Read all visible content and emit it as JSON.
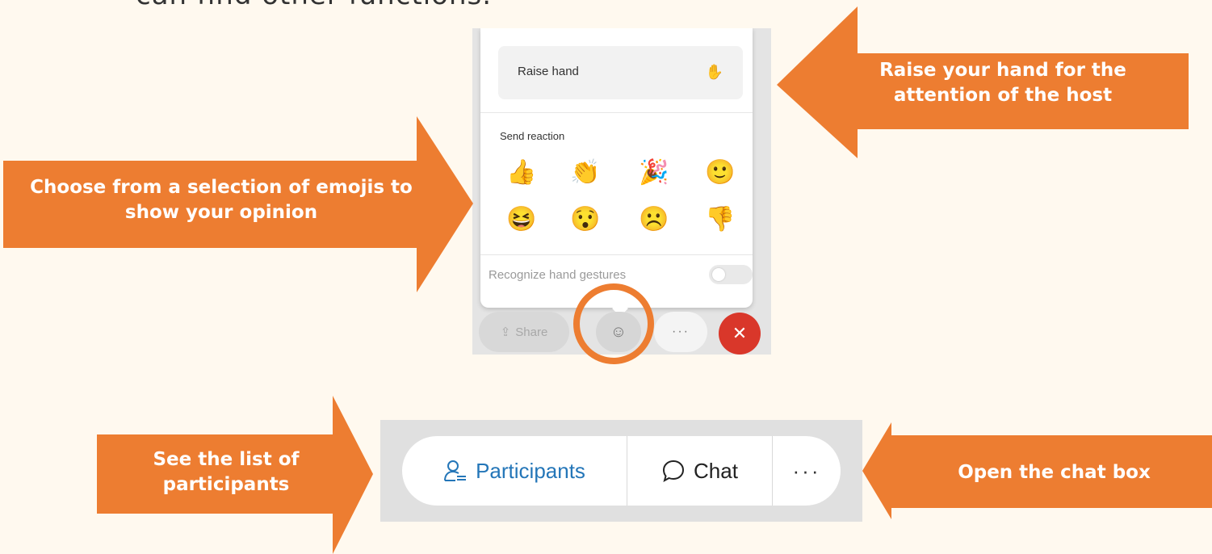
{
  "intro_text": "can find other functions.",
  "callouts": {
    "raise_hand": "Raise your hand for the attention of the host",
    "emojis": "Choose from a selection of emojis to show your opinion",
    "participants": "See the list of participants",
    "chat": "Open the chat box"
  },
  "reaction_panel": {
    "raise_hand_label": "Raise hand",
    "send_reaction_label": "Send reaction",
    "emojis": [
      "👍",
      "👏",
      "🎉",
      "🙂",
      "😆",
      "😯",
      "☹️",
      "👎"
    ],
    "gesture_label": "Recognize hand gestures",
    "share_label": "Share",
    "more_label": "···",
    "end_label": "✕"
  },
  "toolbar": {
    "participants_label": "Participants",
    "chat_label": "Chat",
    "more_label": "···"
  },
  "colors": {
    "accent": "#ed7d31",
    "background": "#fff9ef",
    "participants_blue": "#2476b8",
    "end_red": "#d9372a"
  }
}
